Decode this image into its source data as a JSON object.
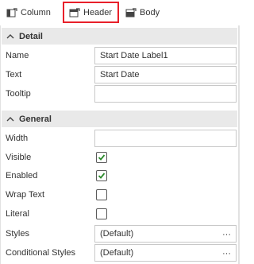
{
  "tabs": [
    {
      "label": "Column",
      "icon": "table-column-icon"
    },
    {
      "label": "Header",
      "icon": "table-header-icon",
      "selected": true
    },
    {
      "label": "Body",
      "icon": "table-body-icon"
    }
  ],
  "sections": {
    "detail": {
      "title": "Detail"
    },
    "general": {
      "title": "General"
    }
  },
  "detail": {
    "name": {
      "label": "Name",
      "value": "Start Date Label1"
    },
    "text": {
      "label": "Text",
      "value": "Start Date"
    },
    "tooltip": {
      "label": "Tooltip",
      "value": ""
    }
  },
  "general": {
    "width": {
      "label": "Width",
      "value": ""
    },
    "visible": {
      "label": "Visible",
      "checked": true
    },
    "enabled": {
      "label": "Enabled",
      "checked": true
    },
    "wrap_text": {
      "label": "Wrap Text",
      "checked": false
    },
    "literal": {
      "label": "Literal",
      "checked": false
    },
    "styles": {
      "label": "Styles",
      "value": "(Default)",
      "button": "···"
    },
    "conditional_styles": {
      "label": "Conditional Styles",
      "value": "(Default)",
      "button": "···"
    }
  },
  "colors": {
    "selected_tab_border": "#e8202a",
    "section_bg": "#e9e9e9",
    "check": "#2a8a2a"
  }
}
